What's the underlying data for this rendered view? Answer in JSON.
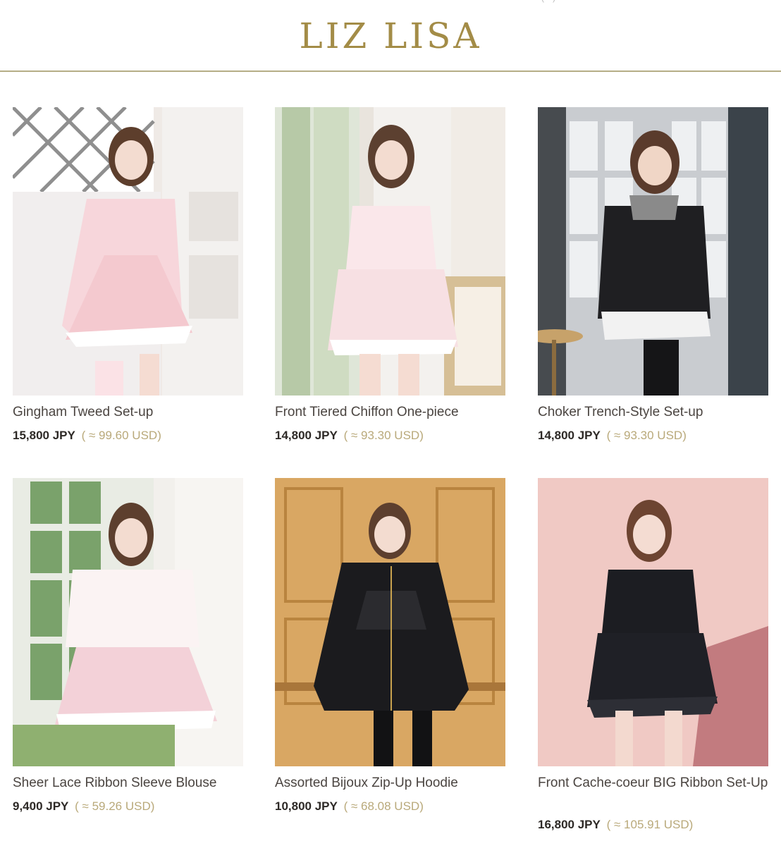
{
  "brand": {
    "logo": "LIZ LISA",
    "top_fragment": "(···)"
  },
  "colors": {
    "accent": "#b5ad86",
    "usd": "#b9a97a",
    "price": "#2d2926",
    "name": "#4b4541"
  },
  "products": [
    {
      "name": "Gingham Tweed Set-up",
      "price_jpy": "15,800 JPY",
      "price_usd": "( ≈ 99.60 USD)"
    },
    {
      "name": "Front Tiered Chiffon One-piece",
      "price_jpy": "14,800 JPY",
      "price_usd": "( ≈ 93.30 USD)"
    },
    {
      "name": "Choker Trench-Style Set-up",
      "price_jpy": "14,800 JPY",
      "price_usd": "( ≈ 93.30 USD)"
    },
    {
      "name": "Sheer Lace Ribbon Sleeve Blouse",
      "price_jpy": "9,400 JPY",
      "price_usd": "( ≈ 59.26 USD)"
    },
    {
      "name": "Assorted Bijoux Zip-Up Hoodie",
      "price_jpy": "10,800 JPY",
      "price_usd": "( ≈ 68.08 USD)"
    },
    {
      "name": "Front Cache-coeur BIG Ribbon Set-Up",
      "price_jpy": "16,800 JPY",
      "price_usd": "( ≈ 105.91 USD)"
    }
  ]
}
